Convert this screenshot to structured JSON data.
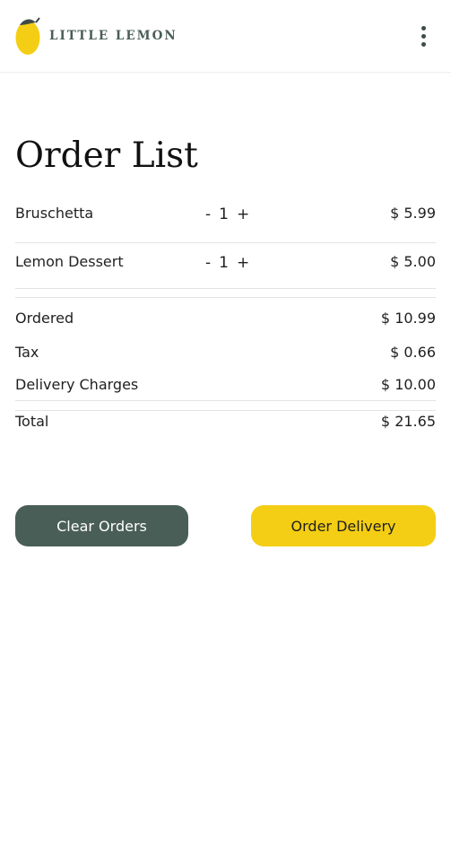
{
  "header": {
    "brand": "LITTLE LEMON",
    "logo_icon": "lemon-logo-icon",
    "menu_icon": "kebab-menu-icon"
  },
  "page": {
    "title": "Order List"
  },
  "order_items": [
    {
      "name": "Bruschetta",
      "qty": "1",
      "price": "$ 5.99",
      "minus": "-",
      "plus": "+"
    },
    {
      "name": "Lemon Dessert",
      "qty": "1",
      "price": "$ 5.00",
      "minus": "-",
      "plus": "+"
    }
  ],
  "summary": {
    "ordered_label": "Ordered",
    "ordered_value": "$ 10.99",
    "tax_label": "Tax",
    "tax_value": "$ 0.66",
    "delivery_label": "Delivery Charges",
    "delivery_value": "$ 10.00",
    "total_label": "Total",
    "total_value": "$ 21.65"
  },
  "actions": {
    "clear_label": "Clear Orders",
    "delivery_label": "Order Delivery"
  },
  "colors": {
    "primary_green": "#495e57",
    "accent_yellow": "#f4ce14"
  }
}
